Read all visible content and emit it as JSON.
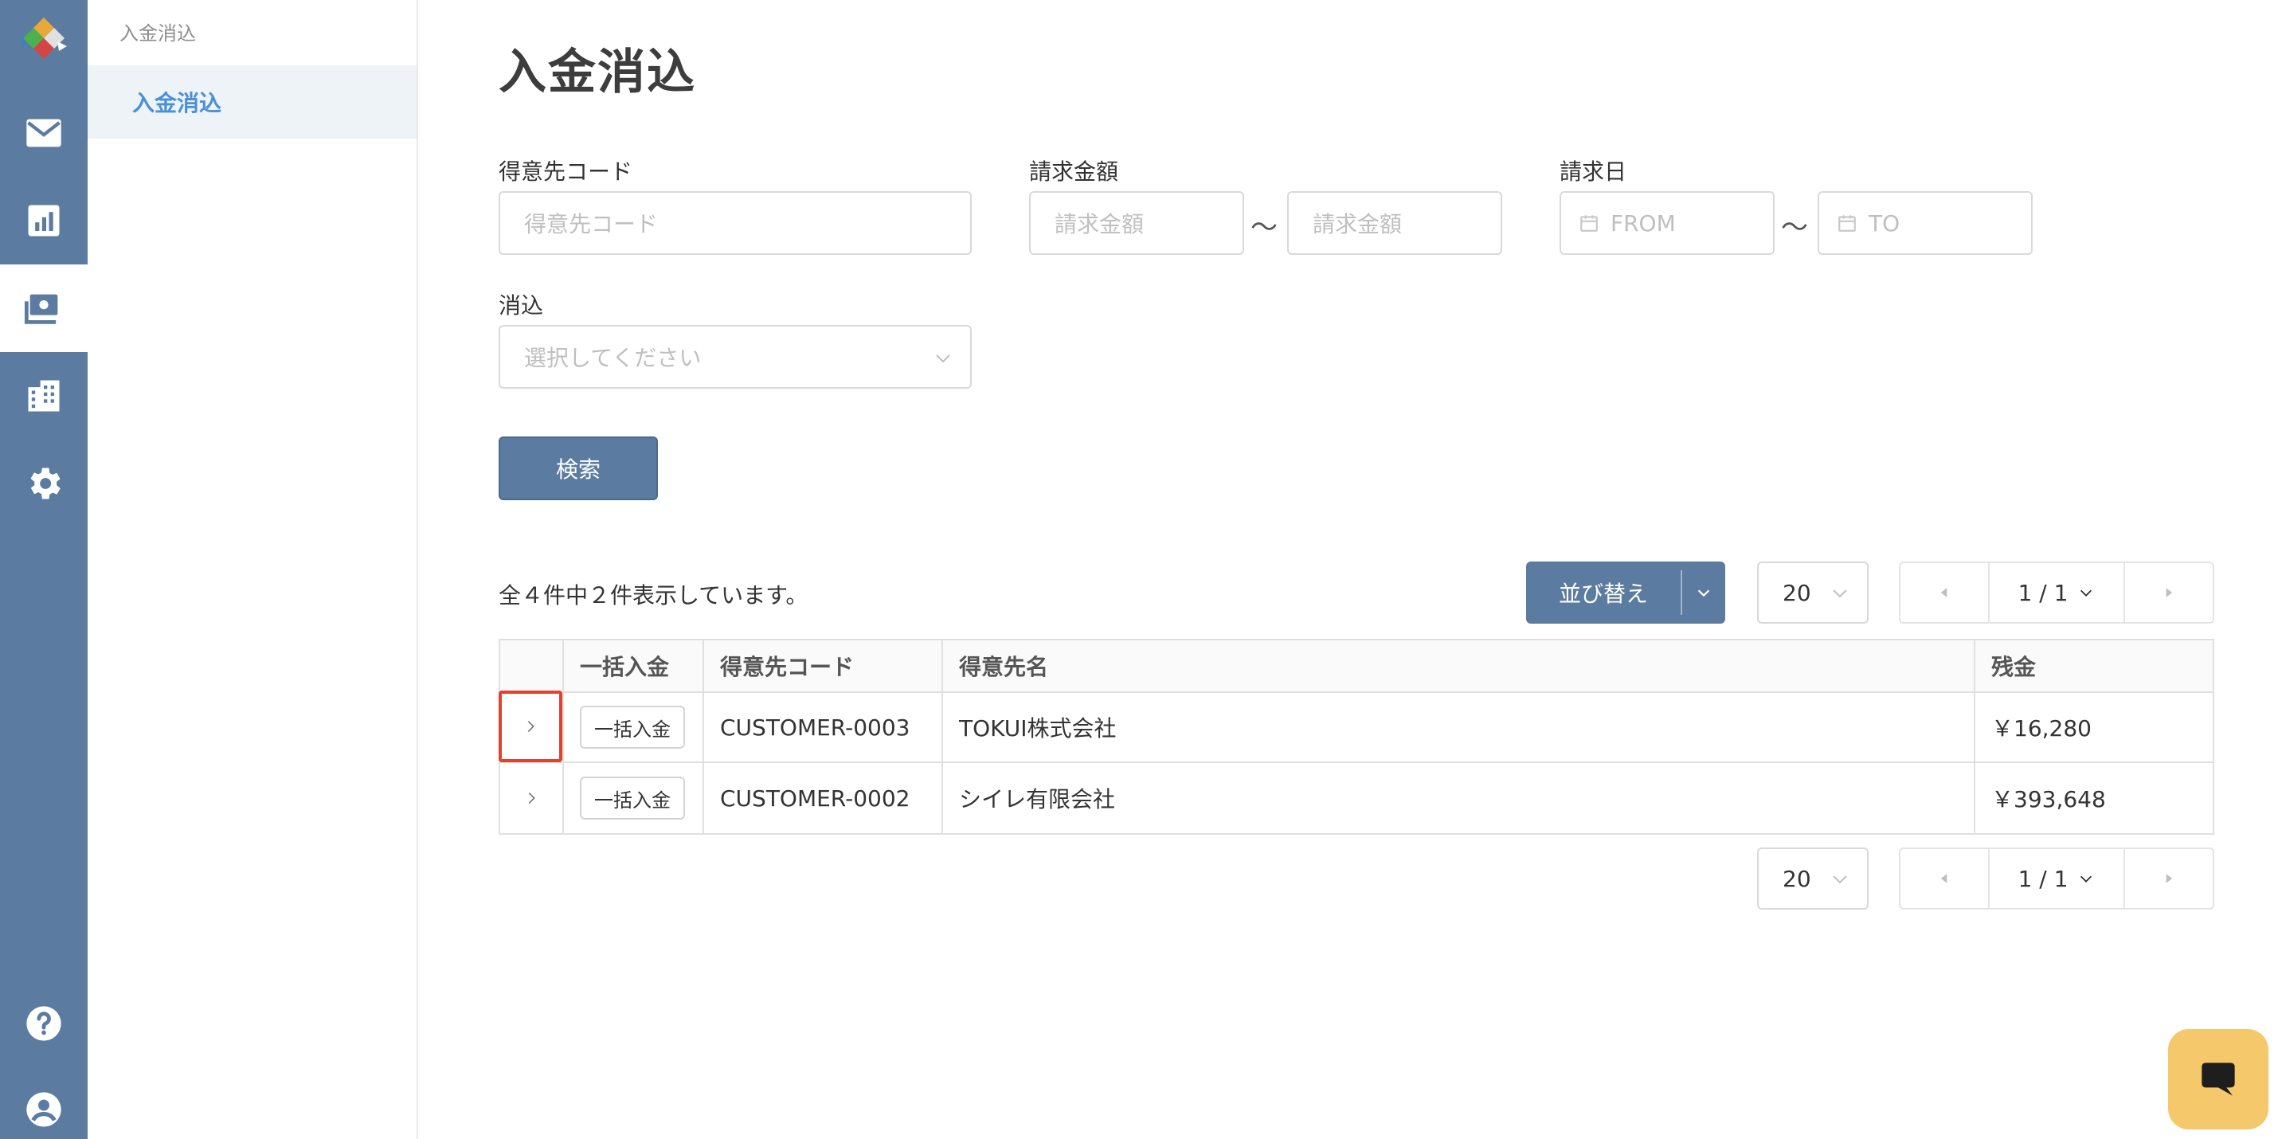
{
  "rail": {
    "items": [
      {
        "name": "mail",
        "active": false
      },
      {
        "name": "chart",
        "active": false
      },
      {
        "name": "payment",
        "active": true
      },
      {
        "name": "building",
        "active": false
      },
      {
        "name": "gear",
        "active": false
      }
    ],
    "bottom": [
      "help",
      "account"
    ]
  },
  "subnav": {
    "header": "入金消込",
    "active_item": "入金消込"
  },
  "page": {
    "title": "入金消込"
  },
  "form": {
    "customer_code_label": "得意先コード",
    "customer_code_placeholder": "得意先コード",
    "amount_label": "請求金額",
    "amount_from_placeholder": "請求金額",
    "amount_to_placeholder": "請求金額",
    "tilde": "〜",
    "date_label": "請求日",
    "date_from_placeholder": "FROM",
    "date_to_placeholder": "TO",
    "reconcile_label": "消込",
    "reconcile_placeholder": "選択してください",
    "search_button": "検索"
  },
  "results": {
    "summary": "全４件中２件表示しています。",
    "sort_label": "並び替え",
    "per_page": "20",
    "page_indicator": "1 / 1"
  },
  "table": {
    "headers": [
      "",
      "一括入金",
      "得意先コード",
      "得意先名",
      "残金"
    ],
    "rows": [
      {
        "bulk_button": "一括入金",
        "code": "CUSTOMER-0003",
        "name": "TOKUI株式会社",
        "balance": "￥16,280"
      },
      {
        "bulk_button": "一括入金",
        "code": "CUSTOMER-0002",
        "name": "シイレ有限会社",
        "balance": "￥393,648"
      }
    ]
  },
  "colors": {
    "rail": "#5b7ba0",
    "primary": "#5b7ba0",
    "accent_link": "#4a90d9",
    "highlight": "#e0432d",
    "chat": "#f5c96b"
  }
}
